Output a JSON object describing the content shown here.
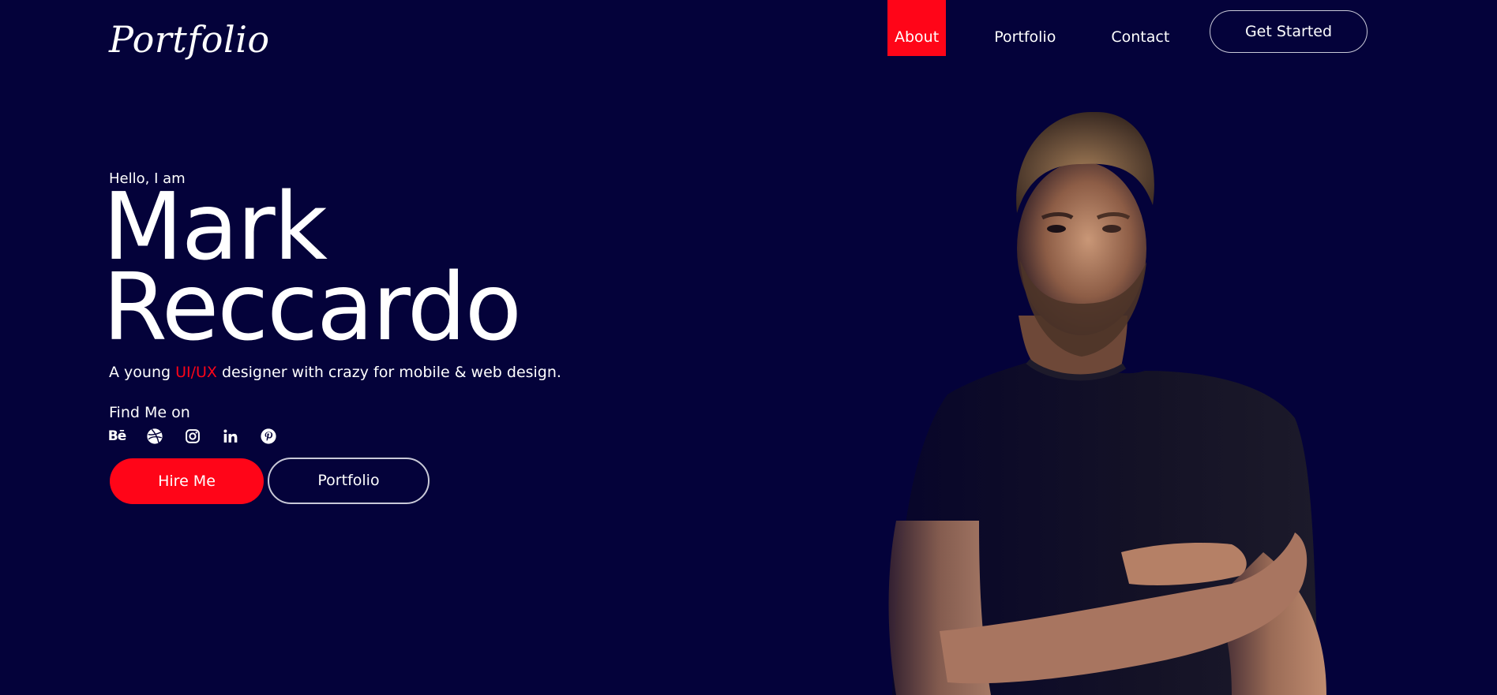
{
  "header": {
    "logo": "Portfolio",
    "nav": [
      {
        "label": "About",
        "active": true
      },
      {
        "label": "Portfolio",
        "active": false
      },
      {
        "label": "Contact",
        "active": false
      }
    ],
    "cta_label": "Get Started"
  },
  "hero": {
    "greeting": "Hello, I am",
    "first_name": "Mark",
    "last_name": "Reccardo",
    "tagline_before": "A young ",
    "tagline_accent": "UI/UX",
    "tagline_after": " designer with crazy for mobile & web design.",
    "find_me_label": "Find Me on",
    "socials": [
      {
        "icon": "behance-icon",
        "text": "Bē"
      },
      {
        "icon": "dribbble-icon"
      },
      {
        "icon": "instagram-icon"
      },
      {
        "icon": "linkedin-icon",
        "text": "in"
      },
      {
        "icon": "pinterest-icon"
      }
    ],
    "hire_label": "Hire Me",
    "portfolio_label": "Portfolio"
  },
  "colors": {
    "background": "#04023a",
    "accent": "#ff0518",
    "text": "#ffffff"
  }
}
